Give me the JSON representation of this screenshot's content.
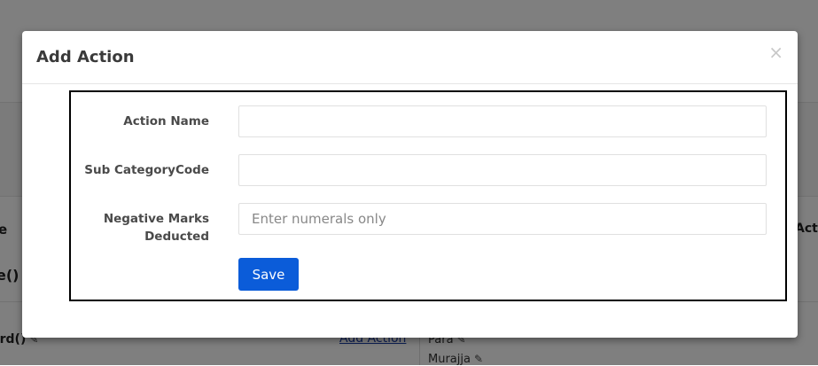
{
  "background": {
    "column_header_left": "e",
    "column_header_right": "Action",
    "row1_name": "e()",
    "row2_name": "ord()",
    "add_action_link": "Add Action",
    "items": [
      "Para",
      "Murajja"
    ],
    "pencil_icon": "pencil-icon"
  },
  "modal": {
    "title": "Add Action",
    "close_label": "×",
    "fields": {
      "action_name": {
        "label": "Action Name",
        "value": "",
        "placeholder": ""
      },
      "sub_category_code": {
        "label": "Sub CategoryCode",
        "value": "",
        "placeholder": ""
      },
      "negative_marks": {
        "label": "Negative Marks Deducted",
        "value": "",
        "placeholder": "Enter numerals only"
      }
    },
    "save_label": "Save"
  },
  "colors": {
    "overlay": "#808080",
    "primary": "#0b5cd9",
    "link": "#1a3ea8"
  }
}
